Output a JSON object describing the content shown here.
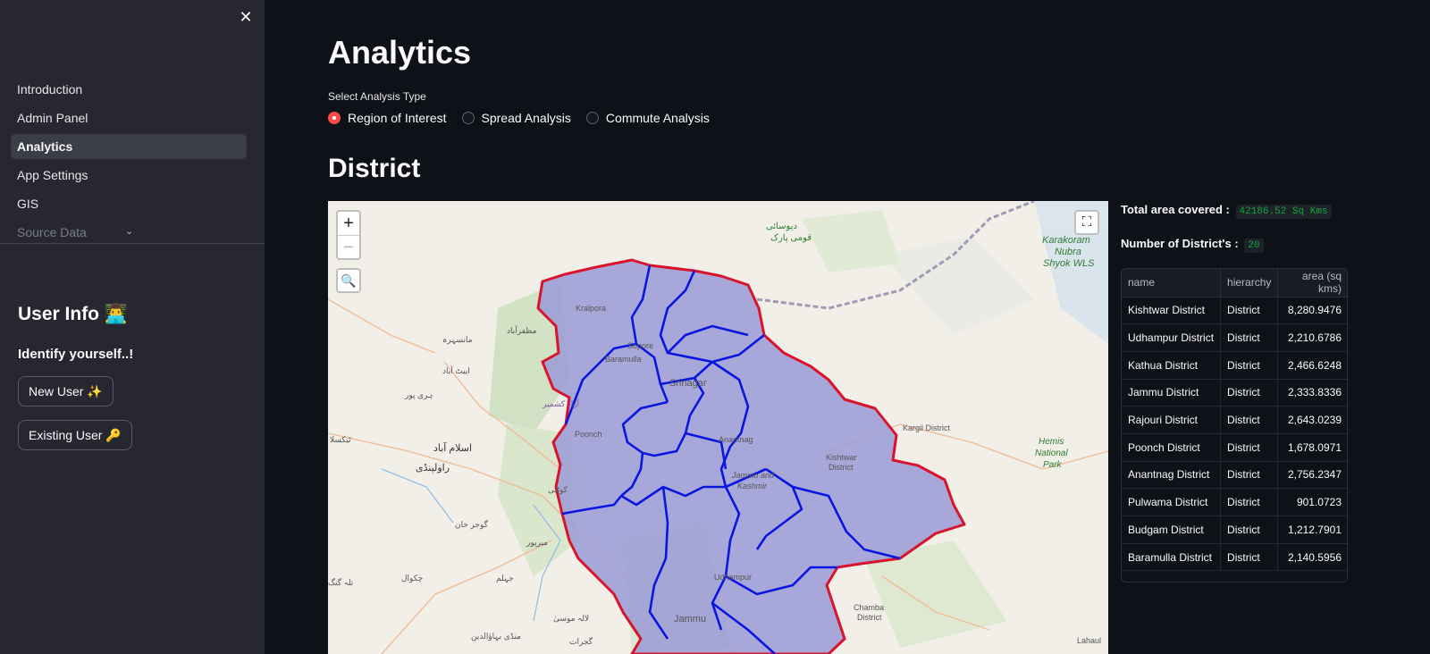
{
  "sidebar": {
    "close_glyph": "✕",
    "nav_items": [
      "Introduction",
      "Admin Panel",
      "Analytics",
      "App Settings",
      "GIS",
      "Source Data"
    ],
    "active_item": "Analytics",
    "chevron_glyph": "⌄",
    "user_info_title": "User Info 👨‍💻",
    "identify_text": "Identify yourself..!",
    "new_user_label": "New User ✨",
    "existing_user_label": "Existing User 🔑"
  },
  "main": {
    "title": "Analytics",
    "radio_label": "Select Analysis Type",
    "radio_options": [
      "Region of Interest",
      "Spread Analysis",
      "Commute Analysis"
    ],
    "selected_option": "Region of Interest",
    "section_title": "District"
  },
  "map": {
    "zoom_in": "+",
    "zoom_out": "−",
    "search_glyph": "🔍",
    "fullscreen_glyph": "⛶",
    "labels": {
      "karakoram": "Karakoram",
      "nubra": "Nubra",
      "shyok": "Shyok WLS",
      "deosai_1": "دیوسائی",
      "deosai_2": "قومی پارک",
      "kralpora": "Kralpora",
      "sopore": "Sopore",
      "baramulla": "Baramulla",
      "srinagar": "Srinagar",
      "anantnag": "Anantnag",
      "poonch": "Poonch",
      "jk_1": "Jammu and",
      "jk_2": "Kashmir",
      "kishtwar_1": "Kishtwar",
      "kishtwar_2": "District",
      "kargil": "Kargil District",
      "hemis_1": "Hemis",
      "hemis_2": "National",
      "hemis_3": "Park",
      "udhampur": "Udhampur",
      "jammu": "Jammu",
      "chamba_1": "Chamba",
      "chamba_2": "District",
      "lahaul": "Lahaul",
      "islamabad": "اسلام آباد",
      "rawalpindi": "راولپنڈی",
      "muzaffarabad": "مظفرآباد",
      "azad": "آزاد کشمیر",
      "mansehra": "مانسہرہ",
      "abbottabad": "ایبٹ آباد",
      "gujar_khan": "گوجر خان",
      "mirpur": "میرپور",
      "jhelum": "جہلم",
      "lala_musa": "لالہ موسیٰ",
      "gujrat": "گجرات",
      "chakwal": "چکوال",
      "talagang": "تلہ گنگ",
      "haripur": "ہری پور",
      "taxila": "ٹیکسلا",
      "kotli": "کوٹلی",
      "mandi": "منڈی بہاؤالدین"
    }
  },
  "stats": {
    "total_area_label": "Total area covered :",
    "total_area_value": "42186.52 Sq Kms",
    "district_count_label": "Number of District's :",
    "district_count_value": "20"
  },
  "table": {
    "columns": [
      "name",
      "hierarchy",
      "area (sq kms)"
    ],
    "rows": [
      [
        "Kishtwar District",
        "District",
        "8,280.9476"
      ],
      [
        "Udhampur District",
        "District",
        "2,210.6786"
      ],
      [
        "Kathua District",
        "District",
        "2,466.6248"
      ],
      [
        "Jammu District",
        "District",
        "2,333.8336"
      ],
      [
        "Rajouri District",
        "District",
        "2,643.0239"
      ],
      [
        "Poonch District",
        "District",
        "1,678.0971"
      ],
      [
        "Anantnag District",
        "District",
        "2,756.2347"
      ],
      [
        "Pulwama District",
        "District",
        "901.0723"
      ],
      [
        "Budgam District",
        "District",
        "1,212.7901"
      ],
      [
        "Baramulla District",
        "District",
        "2,140.5956"
      ]
    ]
  },
  "colors": {
    "accent_red": "#ff4b4b",
    "code_green": "#09ab3b",
    "boundary_red": "#d9132c",
    "district_blue": "#0a16e0",
    "region_fill": "#9a9bd6"
  }
}
